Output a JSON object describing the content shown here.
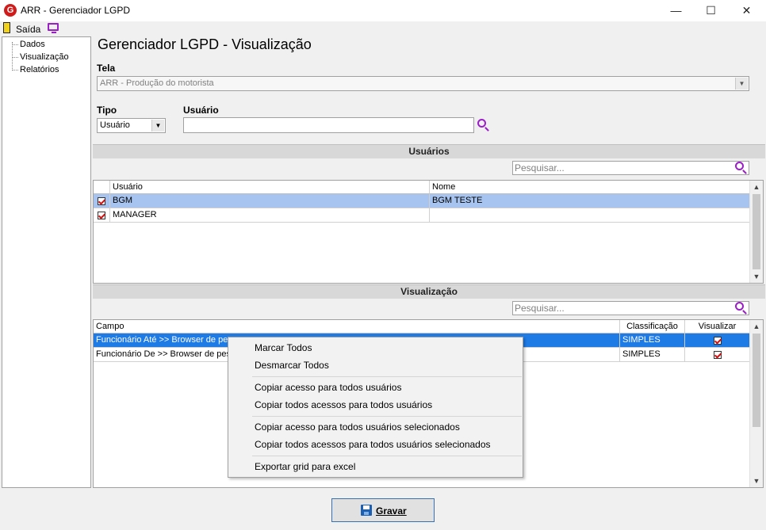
{
  "window": {
    "title": "ARR - Gerenciador LGPD",
    "minimize": "—",
    "maximize": "☐",
    "close": "✕"
  },
  "toolbar": {
    "exit_label": "Saída"
  },
  "sidebar": {
    "items": [
      "Dados",
      "Visualização",
      "Relatórios"
    ]
  },
  "page": {
    "title": "Gerenciador LGPD - Visualização"
  },
  "form": {
    "tela_label": "Tela",
    "tela_value": "ARR - Produção do motorista",
    "tipo_label": "Tipo",
    "tipo_value": "Usuário",
    "usuario_label": "Usuário",
    "usuario_value": ""
  },
  "users_section": {
    "header": "Usuários",
    "search_placeholder": "Pesquisar...",
    "columns": [
      "Usuário",
      "Nome"
    ],
    "rows": [
      {
        "user": "BGM",
        "name": "BGM TESTE",
        "checked": true,
        "selected": true
      },
      {
        "user": "MANAGER",
        "name": "",
        "checked": true,
        "selected": false
      }
    ]
  },
  "view_section": {
    "header": "Visualização",
    "search_placeholder": "Pesquisar...",
    "columns": [
      "Campo",
      "Classificação",
      "Visualizar"
    ],
    "rows": [
      {
        "campo": "Funcionário Até >> Browser de pesq",
        "classificacao": "SIMPLES",
        "visualizar": true,
        "selected": true
      },
      {
        "campo": "Funcionário De >> Browser de pesq",
        "classificacao": "SIMPLES",
        "visualizar": true,
        "selected": false
      }
    ]
  },
  "context_menu": {
    "items": [
      "Marcar Todos",
      "Desmarcar Todos",
      "Copiar acesso para todos usuários",
      "Copiar todos acessos para todos usuários",
      "Copiar acesso para todos usuários selecionados",
      "Copiar todos acessos para todos usuários selecionados",
      "Exportar grid para excel"
    ]
  },
  "footer": {
    "save_label": "Gravar"
  },
  "colors": {
    "selected_row_light": "#a6c4ef",
    "selected_row_strong": "#1e7be6",
    "accent_purple": "#9a1fc9",
    "logo_red": "#d11c1c"
  }
}
